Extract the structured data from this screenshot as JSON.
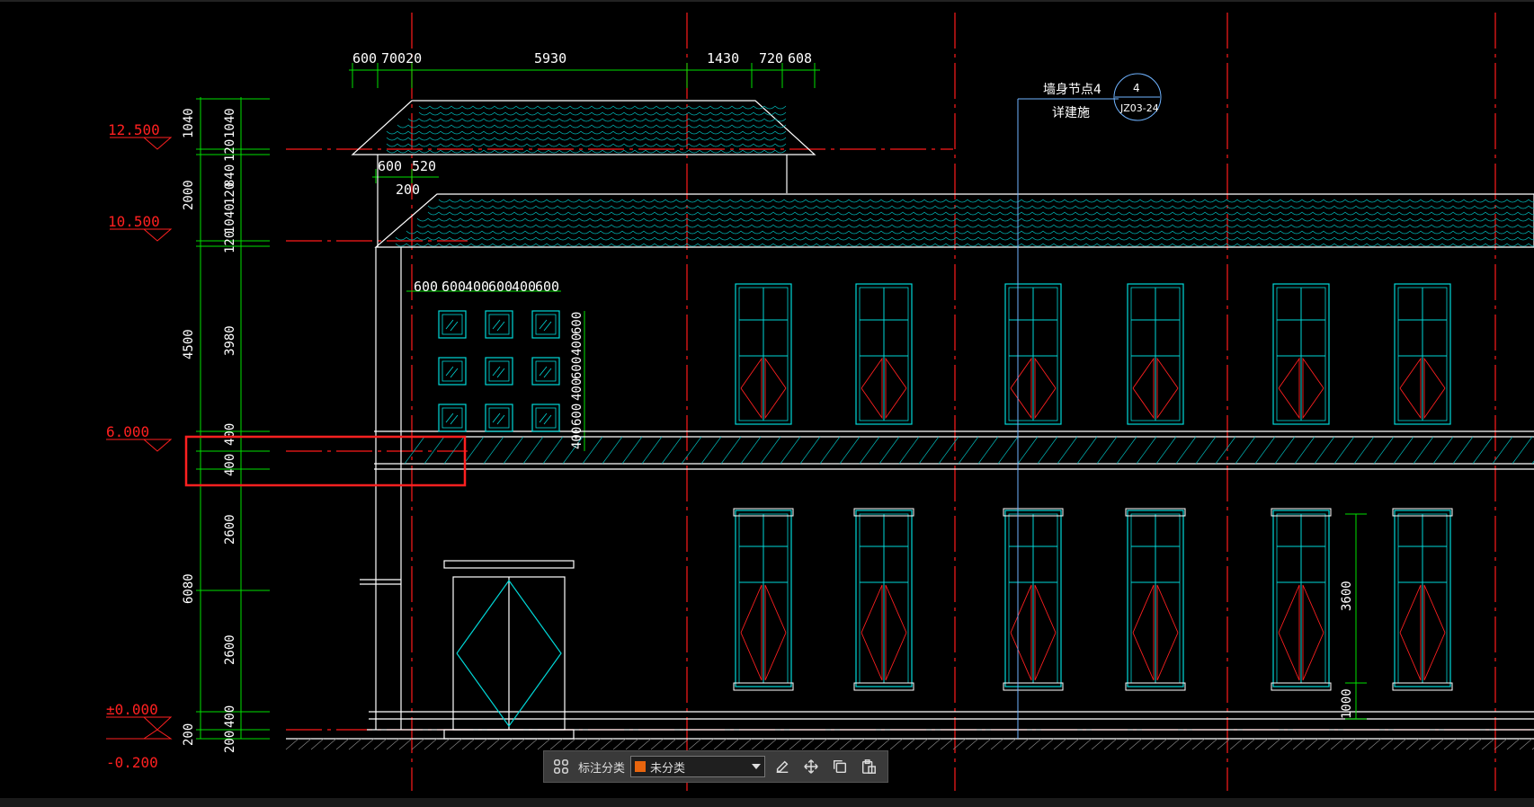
{
  "drawing": {
    "top_dims": [
      "600",
      "70020",
      "5930",
      "1430",
      "720",
      "608"
    ],
    "roof_dims": [
      "600",
      "520",
      "200"
    ],
    "window_dims_h": [
      "600",
      "600",
      "400",
      "600",
      "400",
      "600"
    ],
    "window_dims_v": [
      "400",
      "600",
      "400",
      "600",
      "400",
      "600"
    ],
    "left_dims_outer": [
      "1040",
      "2000",
      "4500",
      "6080",
      "200"
    ],
    "left_dims_inner": [
      "1040",
      "120",
      "840",
      "120",
      "1040",
      "120",
      "3980",
      "400",
      "400",
      "2600",
      "2600",
      "400",
      "200"
    ],
    "elevations": [
      "12.500",
      "10.500",
      "6.000",
      "±0.000",
      "-0.200"
    ],
    "detail_callout": {
      "line1": "墙身节点4",
      "line2": "详建施",
      "num": "4",
      "ref": "JZ03-24"
    },
    "right_dims": [
      "3600",
      "1000"
    ]
  },
  "toolbar": {
    "label": "标注分类",
    "selected": "未分类",
    "swatch_color": "#e8650e"
  },
  "colors": {
    "grid": "#ff1a1a",
    "dim": "#00e000",
    "line": "#ffffff",
    "window": "#00d8d8",
    "highlight": "#ff2020",
    "callout": "#6fb3ff"
  }
}
